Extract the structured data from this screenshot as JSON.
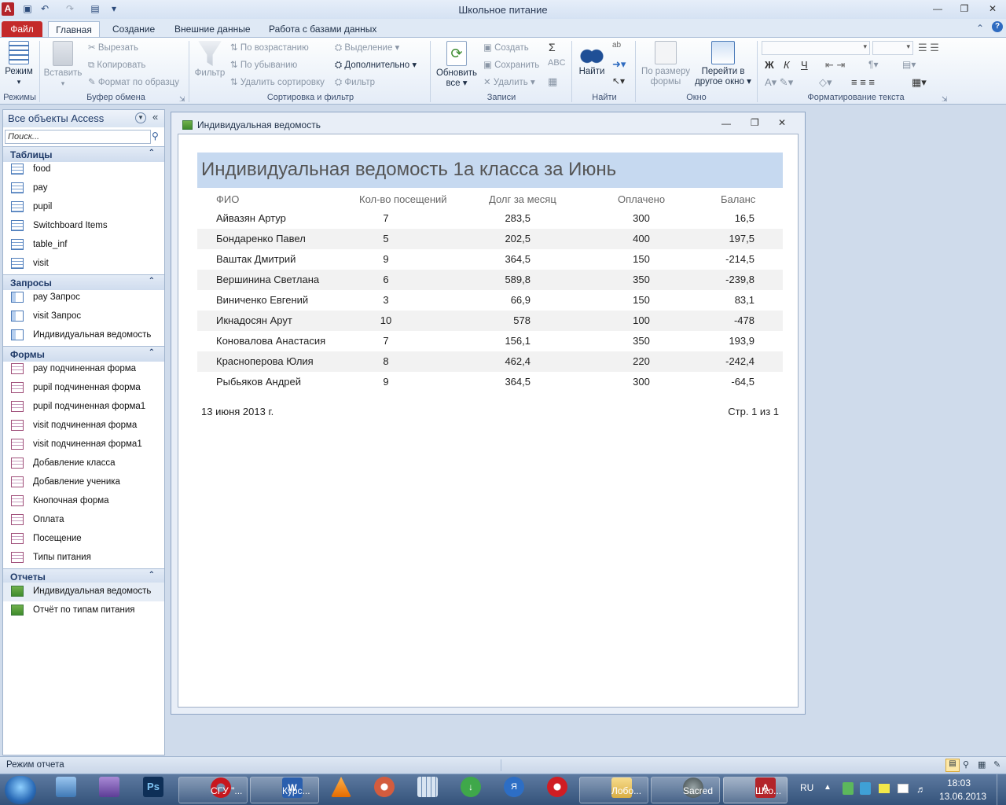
{
  "app": {
    "title": "Школьное питание"
  },
  "ribbon_tabs": [
    "Файл",
    "Главная",
    "Создание",
    "Внешние данные",
    "Работа с базами данных"
  ],
  "ribbon": {
    "views": {
      "mode": "Режим",
      "group": "Режимы"
    },
    "clipboard": {
      "paste": "Вставить",
      "cut": "Вырезать",
      "copy": "Копировать",
      "format_painter": "Формат по образцу",
      "group": "Буфер обмена"
    },
    "sort": {
      "filter": "Фильтр",
      "ascending": "По возрастанию",
      "descending": "По убыванию",
      "remove_sort": "Удалить сортировку",
      "selection": "Выделение",
      "advanced": "Дополнительно",
      "toggle_filter": "Фильтр",
      "group": "Сортировка и фильтр"
    },
    "records": {
      "refresh": "Обновить",
      "refresh2": "все",
      "new": "Создать",
      "save": "Сохранить",
      "delete": "Удалить",
      "group": "Записи"
    },
    "find": {
      "find": "Найти",
      "group": "Найти"
    },
    "window": {
      "fit": "По размеру",
      "fit2": "формы",
      "switch": "Перейти в",
      "switch2": "другое окно",
      "group": "Окно"
    },
    "text": {
      "bold": "Ж",
      "italic": "К",
      "underline": "Ч",
      "group": "Форматирование текста"
    }
  },
  "nav": {
    "title": "Все объекты Access",
    "search_placeholder": "Поиск...",
    "sections": {
      "tables": {
        "label": "Таблицы",
        "items": [
          "food",
          "pay",
          "pupil",
          "Switchboard Items",
          "table_inf",
          "visit"
        ]
      },
      "queries": {
        "label": "Запросы",
        "items": [
          "pay Запрос",
          "visit Запрос",
          "Индивидуальная ведомость"
        ]
      },
      "forms": {
        "label": "Формы",
        "items": [
          "pay подчиненная форма",
          "pupil подчиненная форма",
          "pupil подчиненная форма1",
          "visit подчиненная форма",
          "visit подчиненная форма1",
          "Добавление класса",
          "Добавление ученика",
          "Кнопочная форма",
          "Оплата",
          "Посещение",
          "Типы питания"
        ]
      },
      "reports": {
        "label": "Отчеты",
        "items": [
          "Индивидуальная ведомость",
          "Отчёт по типам питания"
        ]
      }
    }
  },
  "report": {
    "window_title": "Индивидуальная ведомость",
    "heading": "Индивидуальная ведомость  1а класса за  Июнь",
    "columns": [
      "ФИО",
      "Кол-во посещений",
      "Долг за месяц",
      "Оплачено",
      "Баланс"
    ],
    "rows": [
      [
        "Айвазян Артур",
        "7",
        "283,5",
        "300",
        "16,5"
      ],
      [
        "Бондаренко Павел",
        "5",
        "202,5",
        "400",
        "197,5"
      ],
      [
        "Ваштак Дмитрий",
        "9",
        "364,5",
        "150",
        "-214,5"
      ],
      [
        "Вершинина Светлана",
        "6",
        "589,8",
        "350",
        "-239,8"
      ],
      [
        "Виниченко Евгений",
        "3",
        "66,9",
        "150",
        "83,1"
      ],
      [
        "Икнадосян Арут",
        "10",
        "578",
        "100",
        "-478"
      ],
      [
        "Коновалова Анастасия",
        "7",
        "156,1",
        "350",
        "193,9"
      ],
      [
        "Красноперова Юлия",
        "8",
        "462,4",
        "220",
        "-242,4"
      ],
      [
        "Рыбьяков Андрей",
        "9",
        "364,5",
        "300",
        "-64,5"
      ]
    ],
    "footer_date": "13 июня 2013 г.",
    "footer_page": "Стр. 1 из 1"
  },
  "status": {
    "text": "Режим отчета"
  },
  "taskbar": {
    "items": [
      {
        "label": "СГУ \"...",
        "icon": "opera-icon",
        "color": "#c8171e"
      },
      {
        "label": "Курс...",
        "icon": "word-icon",
        "color": "#2a5fae"
      },
      {
        "label": "Лобо...",
        "icon": "folder-icon",
        "color": "#e8c46a"
      },
      {
        "label": "Sacred",
        "icon": "sacred-icon",
        "color": "#4e5b5e"
      },
      {
        "label": "Шко...",
        "icon": "access-icon",
        "color": "#b3242a"
      }
    ],
    "lang": "RU",
    "time": "18:03",
    "date": "13.06.2013"
  }
}
